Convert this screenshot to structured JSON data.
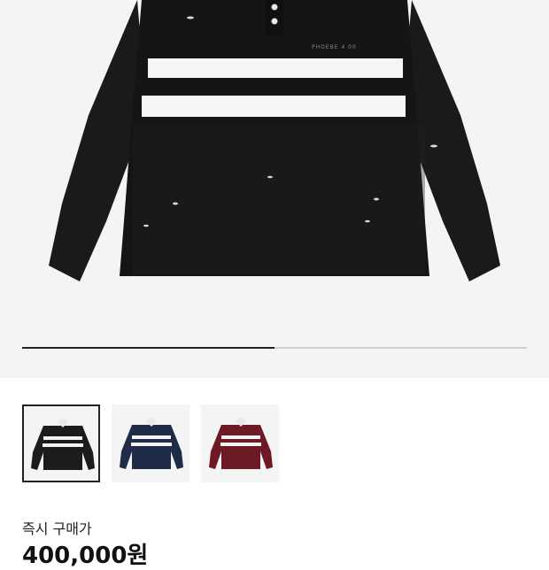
{
  "product": {
    "main_image_icon": "rugby-polo-shirt-black",
    "shirt_logo_text": "PHOEBE 4 00",
    "image_progress": 0.5
  },
  "thumbnails": [
    {
      "icon": "rugby-polo-shirt-black",
      "color": "#1c1c1c",
      "selected": true
    },
    {
      "icon": "rugby-polo-shirt-navy",
      "color": "#1e2c48",
      "selected": false
    },
    {
      "icon": "rugby-polo-shirt-burgundy",
      "color": "#6e1a24",
      "selected": false
    }
  ],
  "price": {
    "label": "즉시 구매가",
    "value": "400,000원"
  },
  "colors": {
    "background": "#ffffff",
    "image_background": "#f4f4f4",
    "progress_fill": "#222222",
    "progress_track": "#d0d0d0"
  }
}
